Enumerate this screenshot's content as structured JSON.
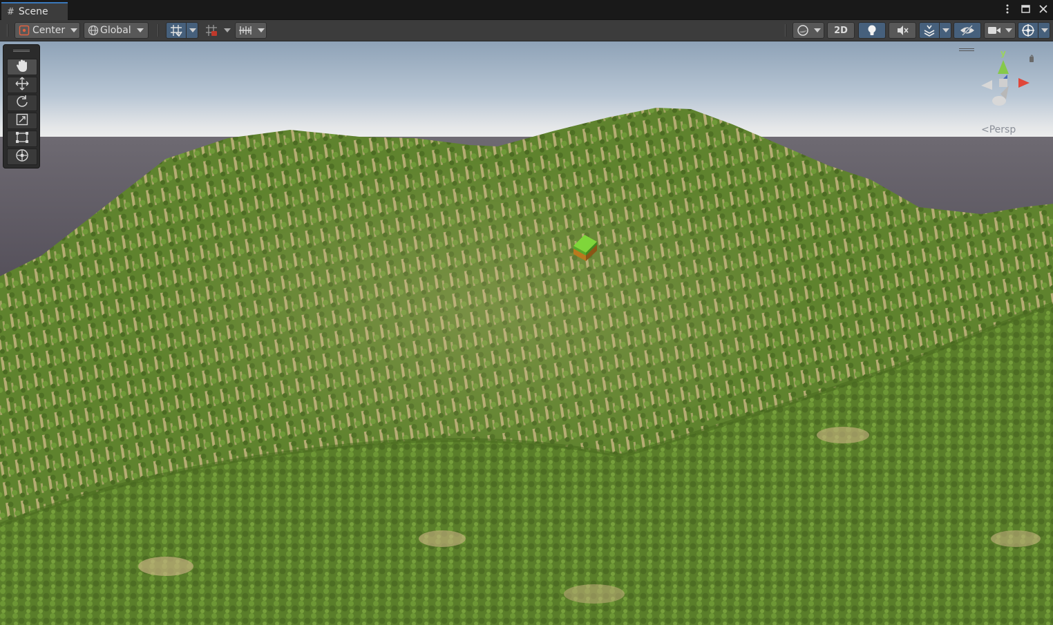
{
  "tab": {
    "title": "Scene",
    "icon": "grid-hash-icon"
  },
  "window_controls": [
    "kebab-menu-icon",
    "maximize-icon",
    "close-icon"
  ],
  "toolbar": {
    "pivot_label": "Center",
    "space_label": "Global",
    "mode_2d_label": "2D",
    "colors": {
      "active": "#46607c",
      "button": "#585858",
      "bar": "#3c3c3c"
    }
  },
  "tools": [
    "hand-tool-icon",
    "move-tool-icon",
    "rotate-tool-icon",
    "scale-tool-icon",
    "rect-tool-icon",
    "transform-tool-icon"
  ],
  "gizmo": {
    "axis_y": "y",
    "projection_label": "<Persp"
  },
  "scene": {
    "sky_color": "#b7c6d6",
    "ground_color": "#58525c",
    "grass_color": "#5b7d2c",
    "sand_color": "#d2b98a"
  }
}
